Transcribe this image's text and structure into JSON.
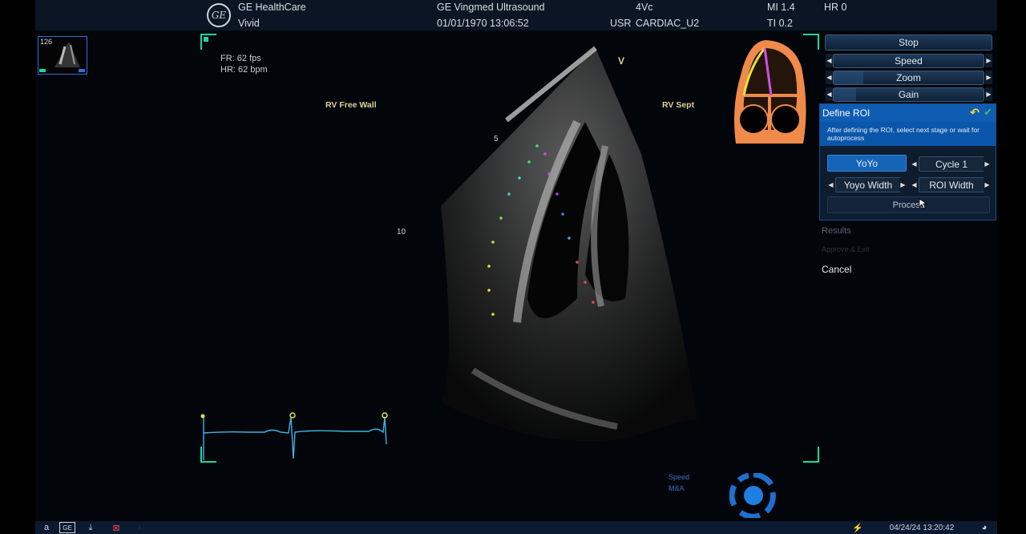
{
  "header": {
    "vendor": "GE HealthCare",
    "product": "Vivid",
    "system": "GE Vingmed Ultrasound",
    "datetime": "01/01/1970 13:06:52",
    "probe": "4Vc",
    "user": "USR",
    "preset": "CARDIAC_U2",
    "mi": "MI 1.4",
    "ti": "TI 0.2",
    "hr": "HR 0",
    "logo_text": "GE"
  },
  "thumbnail": {
    "number": "126"
  },
  "image": {
    "frame_rate": "FR: 62 fps",
    "heart_rate": "HR: 62 bpm",
    "label_left": "RV Free Wall",
    "label_right": "RV Sept",
    "orientation_marker": "V",
    "depth_5": "5",
    "depth_10": "10"
  },
  "controls": {
    "stop": "Stop",
    "speed": "Speed",
    "zoom": "Zoom",
    "gain": "Gain",
    "zoom_level": 0.2,
    "gain_level": 0.15
  },
  "roi_panel": {
    "title": "Define ROI",
    "description": "After defining the ROI, select next stage or wait for autoprocess",
    "yoyo": "YoYo",
    "cycle": "Cycle 1",
    "yoyo_width": "Yoyo Width",
    "roi_width": "ROI Width",
    "process": "Process"
  },
  "side_menu": {
    "results": "Results",
    "approve": "Approve & Exit",
    "cancel": "Cancel"
  },
  "trackball": {
    "label1": "Speed",
    "label2": "M&A"
  },
  "footer": {
    "timestamp": "04/24/24 13:20:42",
    "a_label": "a",
    "ge_label": "GE"
  },
  "colors": {
    "accent": "#0f5cb3",
    "frame_corner": "#1ed7a0",
    "ecg": "#3fb6e6",
    "heart_outline": "#f08a4b"
  }
}
